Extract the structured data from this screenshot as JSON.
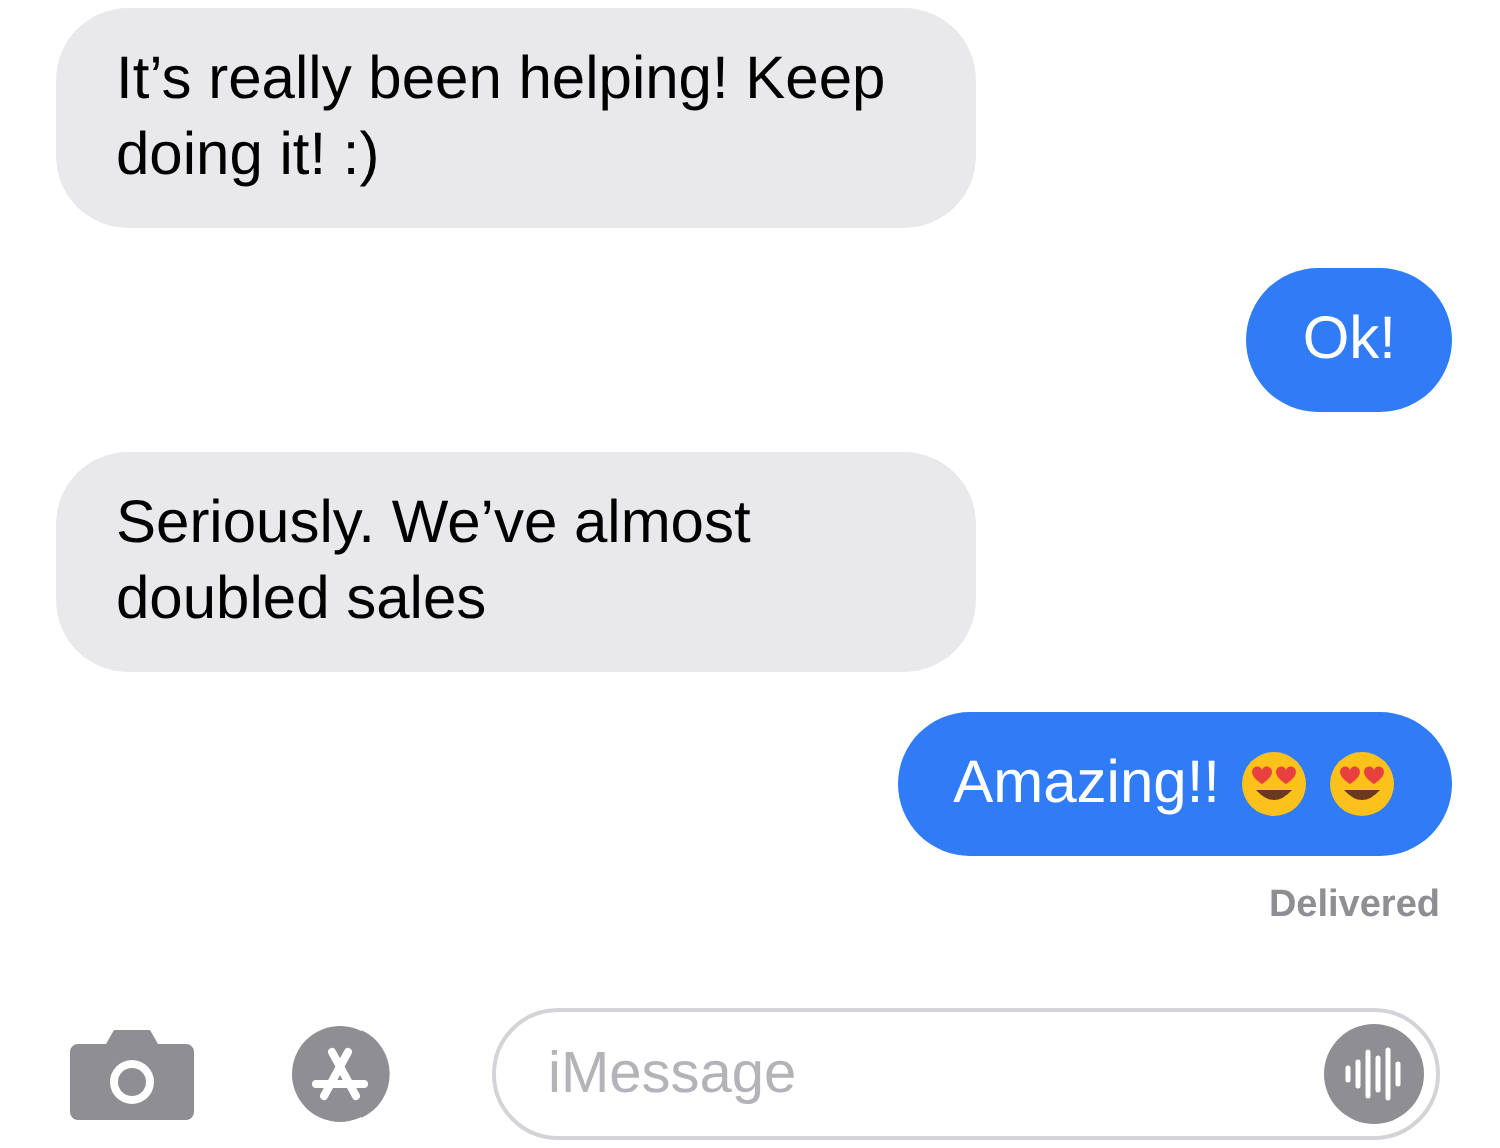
{
  "messages": [
    {
      "kind": "received",
      "text": "It’s really been helping! Keep doing it! :)"
    },
    {
      "kind": "sent",
      "text": "Ok!"
    },
    {
      "kind": "received",
      "text": "Seriously. We’ve almost doubled sales"
    },
    {
      "kind": "sent",
      "text": "Amazing!!",
      "emoji_after": true
    }
  ],
  "status": "Delivered",
  "composer": {
    "placeholder": "iMessage"
  }
}
